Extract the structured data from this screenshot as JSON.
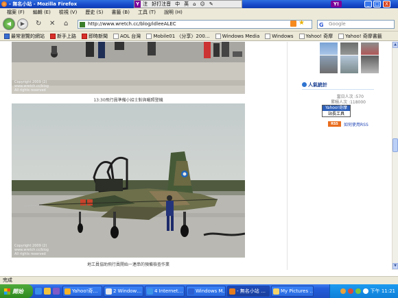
{
  "window": {
    "title": "- 無名小站 - Mozilla Firefox",
    "ime": [
      "Y",
      "注",
      "好打注音",
      "中",
      "英",
      "⌂",
      "☺",
      "✎"
    ],
    "yahoo_icon": "Y!",
    "controls": [
      "_",
      "□",
      "X"
    ]
  },
  "menu": [
    "檔案 (F)",
    "編輯 (E)",
    "檢視 (V)",
    "歷史 (S)",
    "書籤 (B)",
    "工具 (T)",
    "說明 (H)"
  ],
  "nav": {
    "back_icon": "back-arrow",
    "forward_icon": "forward-arrow",
    "url": "http://www.wretch.cc/blog/idleeALEC",
    "search_placeholder": "Google"
  },
  "bookmarks": [
    {
      "label": "最常瀏覽的網站",
      "icon": "folder"
    },
    {
      "label": "新手上路",
      "icon": "red"
    },
    {
      "label": "即時新聞",
      "icon": "folder"
    },
    {
      "label": "AOL 台灣",
      "icon": "folder"
    },
    {
      "label": "Mobile01 〈分享〉200…",
      "icon": "folder"
    },
    {
      "label": "Windows Media",
      "icon": "folder"
    },
    {
      "label": "Windows",
      "icon": "folder"
    },
    {
      "label": "Yahoo! 奇摩",
      "icon": "folder"
    },
    {
      "label": "Yahoo! 奇摩書籤",
      "icon": "folder"
    }
  ],
  "content": {
    "caption_top": "13:30飛行員準備小招士對與曬照登機",
    "caption_main": "地工員協助飛行員開始一連串的預備檢查作業",
    "photo_stamp_top": "Copyright 2009 (2)\nwww.wretch.cc/blog\nAll rights reserved",
    "photo_stamp_main": "Copyright 2009 (2)\nwww.wretch.cc/blog\nAll rights reserved"
  },
  "sidebar": {
    "section_title": "人氣統計",
    "stat_today": "當日人次 :570",
    "stat_total": "累積人次 :118000",
    "button_top": "Yahoo!奇摩",
    "button_bottom": "站長工具",
    "rss_badge": "RSS",
    "rss_link": "如何使用RSS"
  },
  "status": {
    "text": "完成"
  },
  "taskbar": {
    "start": "開始",
    "tasks": [
      {
        "label": "Yahoo!奇…",
        "color": "#f6b327"
      },
      {
        "label": "2 Window…",
        "color": "#e7e7e7"
      },
      {
        "label": "4 Internet…",
        "color": "#3d95e8"
      },
      {
        "label": "Windows M…",
        "color": "#2c5fd0"
      },
      {
        "label": "- 無名小站 …",
        "color": "#e57c1e"
      },
      {
        "label": "My Pictures …",
        "color": "#f3d36a"
      }
    ],
    "clock": "下午 11:21"
  }
}
